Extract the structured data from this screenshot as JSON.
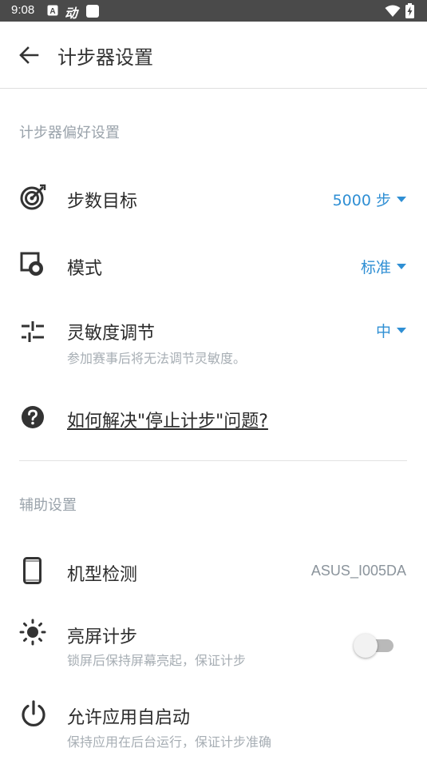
{
  "status_bar": {
    "time": "9:08",
    "app_icon_text": "动"
  },
  "toolbar": {
    "title": "计步器设置"
  },
  "pedometer_prefs": {
    "section_title": "计步器偏好设置",
    "step_goal": {
      "label": "步数目标",
      "value": "5000 步"
    },
    "mode": {
      "label": "模式",
      "value": "标准"
    },
    "sensitivity": {
      "label": "灵敏度调节",
      "value": "中",
      "subtitle": "参加赛事后将无法调节灵敏度。"
    },
    "help_link": {
      "label": "如何解决\"停止计步\"问题?"
    }
  },
  "aux_settings": {
    "section_title": "辅助设置",
    "device_model": {
      "label": "机型检测",
      "value": "ASUS_I005DA"
    },
    "screen_on": {
      "label": "亮屏计步",
      "subtitle": "锁屏后保持屏幕亮起，保证计步",
      "enabled": false
    },
    "autostart": {
      "label": "允许应用自启动",
      "subtitle": "保持应用在后台运行，保证计步准确"
    }
  },
  "colors": {
    "accent": "#2f8fd4",
    "status_bar": "#4a4a4a",
    "section_title": "#9aa3ab"
  }
}
